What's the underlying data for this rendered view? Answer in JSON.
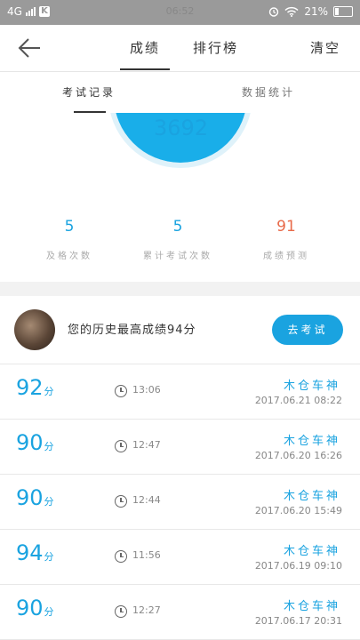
{
  "status_bar": {
    "network": "4G",
    "time": "06:52",
    "battery": "21%"
  },
  "nav": {
    "tab_score": "成绩",
    "tab_rank": "排行榜",
    "clear": "清空"
  },
  "sub_tabs": {
    "record": "考试记录",
    "stats": "数据统计"
  },
  "gauge": {
    "value": "3692"
  },
  "stats": [
    {
      "value": "5",
      "label": "及格次数"
    },
    {
      "value": "5",
      "label": "累计考试次数"
    },
    {
      "value": "91",
      "label": "成绩预测"
    }
  ],
  "best": {
    "text": "您的历史最高成绩94分",
    "button": "去考试"
  },
  "records": [
    {
      "score": "92",
      "unit": "分",
      "time": "13:06",
      "name": "木仓车神",
      "date": "2017.06.21  08:22"
    },
    {
      "score": "90",
      "unit": "分",
      "time": "12:47",
      "name": "木仓车神",
      "date": "2017.06.20  16:26"
    },
    {
      "score": "90",
      "unit": "分",
      "time": "12:44",
      "name": "木仓车神",
      "date": "2017.06.20  15:49"
    },
    {
      "score": "94",
      "unit": "分",
      "time": "11:56",
      "name": "木仓车神",
      "date": "2017.06.19  09:10"
    },
    {
      "score": "90",
      "unit": "分",
      "time": "12:27",
      "name": "木仓车神",
      "date": "2017.06.17  20:31"
    }
  ]
}
